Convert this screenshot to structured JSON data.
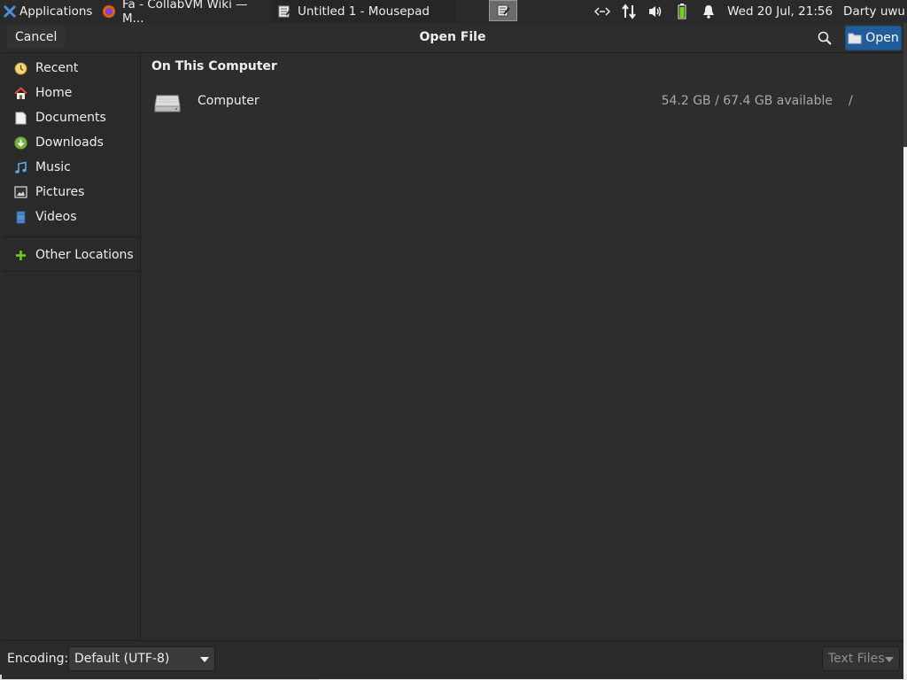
{
  "panel": {
    "applications_label": "Applications",
    "tasks": [
      {
        "label": "Fa - CollabVM Wiki — M...",
        "icon": "firefox-icon"
      },
      {
        "label": "Untitled 1 - Mousepad",
        "icon": "text-editor-icon"
      }
    ],
    "clock": "Wed 20 Jul, 21:56",
    "user": "Darty uwu"
  },
  "dialog": {
    "title": "Open File",
    "cancel_label": "Cancel",
    "open_label": "Open",
    "accent_color": "#215d9c"
  },
  "sidebar": {
    "items": [
      {
        "label": "Recent",
        "icon": "recent-icon"
      },
      {
        "label": "Home",
        "icon": "home-icon"
      },
      {
        "label": "Documents",
        "icon": "documents-icon"
      },
      {
        "label": "Downloads",
        "icon": "downloads-icon"
      },
      {
        "label": "Music",
        "icon": "music-icon"
      },
      {
        "label": "Pictures",
        "icon": "pictures-icon"
      },
      {
        "label": "Videos",
        "icon": "videos-icon"
      }
    ],
    "other_locations": {
      "label": "Other Locations",
      "icon": "plus-icon"
    }
  },
  "main": {
    "section_title": "On This Computer",
    "locations": [
      {
        "name": "Computer",
        "space": "54.2 GB / 67.4 GB available",
        "path": "/",
        "icon": "drive-icon"
      }
    ]
  },
  "footer": {
    "encoding_label": "Encoding:",
    "encoding_value": "Default (UTF-8)",
    "filter_value": "Text Files"
  }
}
